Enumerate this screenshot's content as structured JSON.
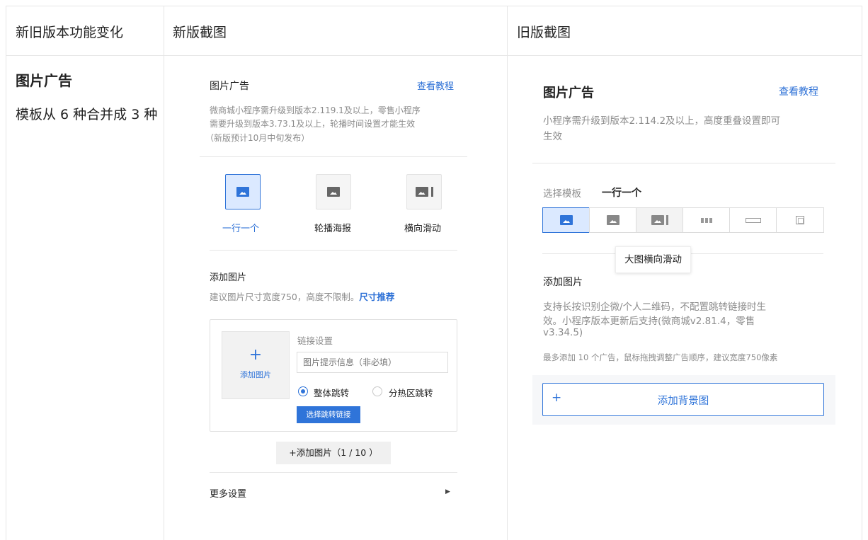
{
  "table": {
    "col1_header": "新旧版本功能变化",
    "col2_header": "新版截图",
    "col3_header": "旧版截图"
  },
  "feature": {
    "name": "图片广告",
    "change": "模板从 6 种合并成 3 种"
  },
  "new": {
    "title": "图片广告",
    "tutorial": "查看教程",
    "note_l1": "微商城小程序需升级到版本2.119.1及以上，零售小程序",
    "note_l2": "需要升级到版本3.73.1及以上，轮播时间设置才能生效",
    "note_l3": "（新版预计10月中旬发布）",
    "templates": [
      {
        "label": "一行一个"
      },
      {
        "label": "轮播海报"
      },
      {
        "label": "横向滑动"
      }
    ],
    "add_title": "添加图片",
    "add_desc": "建议图片尺寸宽度750，高度不限制。",
    "size_link": "尺寸推荐",
    "upload_plus": "+",
    "upload_label": "添加图片",
    "link_settings": "链接设置",
    "hint_placeholder": "图片提示信息（非必填）",
    "radio_whole": "整体跳转",
    "radio_zone": "分热区跳转",
    "choose_link": "选择跳转链接",
    "add_btn": "+添加图片（1 / 10 ）",
    "more": "更多设置",
    "more_arrow": "▶"
  },
  "old": {
    "title": "图片广告",
    "tutorial": "查看教程",
    "note_l1": "小程序需升级到版本2.114.2及以上，高度重叠设置即可",
    "note_l2": "生效",
    "template_label": "选择模板",
    "template_value": "一行一个",
    "tooltip": "大图横向滑动",
    "add_title": "添加图片",
    "support_l1": "支持长按识别企微/个人二维码，不配置跳转链接时生",
    "support_l2": "效。小程序版本更新后支持(微商城v2.81.4，零售",
    "support_l3": "v3.34.5)",
    "max_note": "最多添加 10 个广告，鼠标拖拽调整广告顺序，建议宽度750像素",
    "add_bg_plus": "+",
    "add_bg": "添加背景图"
  },
  "colors": {
    "accent": "#2f74d9",
    "border": "#e6e6e6"
  }
}
